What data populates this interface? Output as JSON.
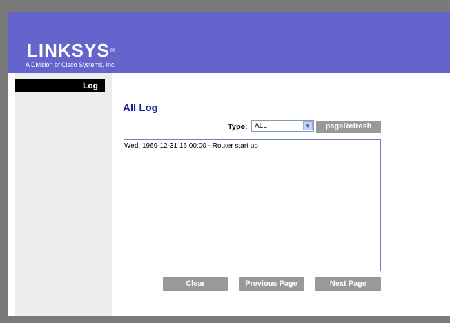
{
  "brand": {
    "logo_text": "LINKSYS",
    "registered_mark": "®",
    "tagline": "A Division of Cisco Systems, Inc."
  },
  "sidebar": {
    "active_tab": "Log"
  },
  "main": {
    "title": "All Log",
    "type_label": "Type:",
    "type_value": "ALL",
    "refresh_label": "pageRefresh",
    "log_lines": [
      "Wed, 1969-12-31 16:00:00 - Router start up"
    ],
    "clear_label": "Clear",
    "previous_label": "Previous Page",
    "next_label": "Next Page"
  },
  "colors": {
    "banner": "#6464cc",
    "title": "#1c1ca0",
    "button": "#999999",
    "sidebar": "#ececec"
  }
}
